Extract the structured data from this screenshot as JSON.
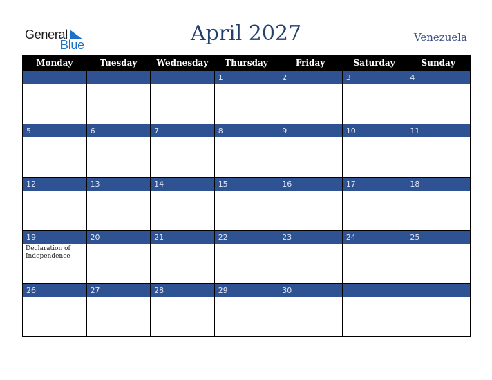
{
  "logo": {
    "line1": "General",
    "line2": "Blue"
  },
  "header": {
    "title": "April 2027",
    "country": "Venezuela"
  },
  "weekdays": [
    "Monday",
    "Tuesday",
    "Wednesday",
    "Thursday",
    "Friday",
    "Saturday",
    "Sunday"
  ],
  "weeks": [
    [
      {
        "day": ""
      },
      {
        "day": ""
      },
      {
        "day": ""
      },
      {
        "day": "1"
      },
      {
        "day": "2"
      },
      {
        "day": "3"
      },
      {
        "day": "4"
      }
    ],
    [
      {
        "day": "5"
      },
      {
        "day": "6"
      },
      {
        "day": "7"
      },
      {
        "day": "8"
      },
      {
        "day": "9"
      },
      {
        "day": "10"
      },
      {
        "day": "11"
      }
    ],
    [
      {
        "day": "12"
      },
      {
        "day": "13"
      },
      {
        "day": "14"
      },
      {
        "day": "15"
      },
      {
        "day": "16"
      },
      {
        "day": "17"
      },
      {
        "day": "18"
      }
    ],
    [
      {
        "day": "19",
        "event": "Declaration of Independence"
      },
      {
        "day": "20"
      },
      {
        "day": "21"
      },
      {
        "day": "22"
      },
      {
        "day": "23"
      },
      {
        "day": "24"
      },
      {
        "day": "25"
      }
    ],
    [
      {
        "day": "26"
      },
      {
        "day": "27"
      },
      {
        "day": "28"
      },
      {
        "day": "29"
      },
      {
        "day": "30"
      },
      {
        "day": ""
      },
      {
        "day": ""
      }
    ]
  ],
  "colors": {
    "band": "#2e5292",
    "title": "#23406b",
    "header_bg": "#000000",
    "logo_blue": "#1a73c8"
  }
}
